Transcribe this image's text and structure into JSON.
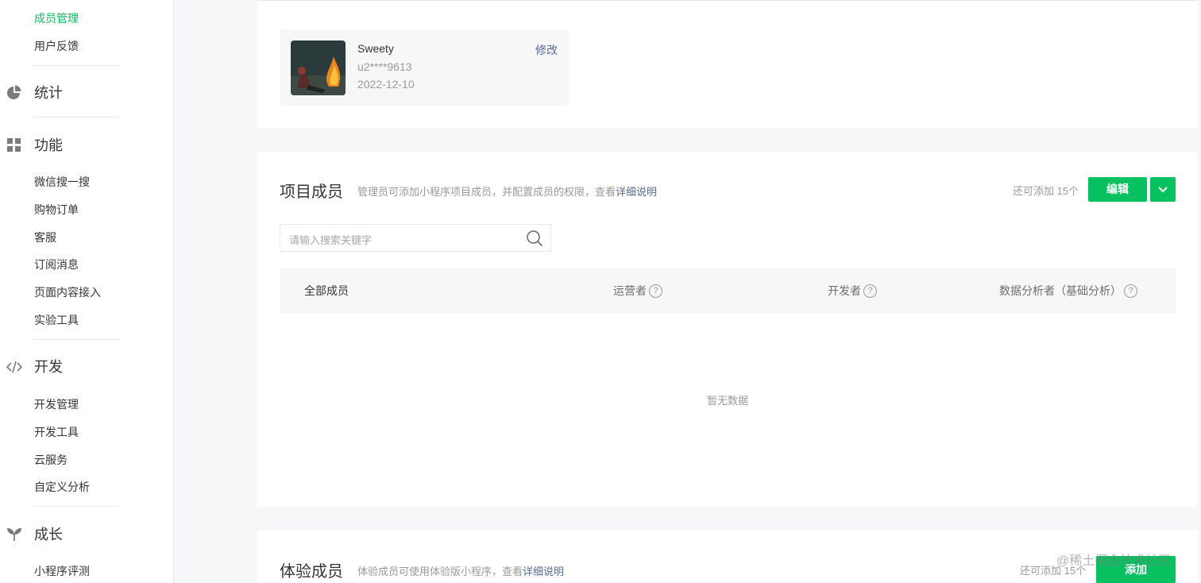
{
  "sidebar": {
    "top_items": [
      "成员管理",
      "用户反馈"
    ],
    "stats": {
      "label": "统计",
      "icon": "pie-chart-icon"
    },
    "features": {
      "label": "功能",
      "icon": "grid-icon",
      "items": [
        "微信搜一搜",
        "购物订单",
        "客服",
        "订阅消息",
        "页面内容接入",
        "实验工具"
      ]
    },
    "dev": {
      "label": "开发",
      "icon": "code-icon",
      "items": [
        "开发管理",
        "开发工具",
        "云服务",
        "自定义分析"
      ]
    },
    "growth": {
      "label": "成长",
      "icon": "sprout-icon",
      "items": [
        "小程序评测"
      ]
    }
  },
  "admin": {
    "name": "Sweety",
    "id": "u2****9613",
    "date": "2022-12-10",
    "edit_label": "修改"
  },
  "project_members": {
    "title": "项目成员",
    "desc": "管理员可添加小程序项目成员，并配置成员的权限，查看",
    "desc_link": "详细说明",
    "quota": "还可添加 15个",
    "edit_button": "编辑",
    "search_placeholder": "请输入搜索关键字",
    "columns": [
      "全部成员",
      "运营者",
      "开发者",
      "数据分析者（基础分析）"
    ],
    "help_mark": "?",
    "empty_text": "暂无数据"
  },
  "trial_members": {
    "title": "体验成员",
    "desc": "体验成员可使用体验版小程序，查看",
    "desc_link": "详细说明",
    "quota": "还可添加 15个",
    "add_button": "添加"
  },
  "watermark": "@稀土掘金技术社区",
  "colors": {
    "accent": "#07c160",
    "link": "#576b95"
  }
}
